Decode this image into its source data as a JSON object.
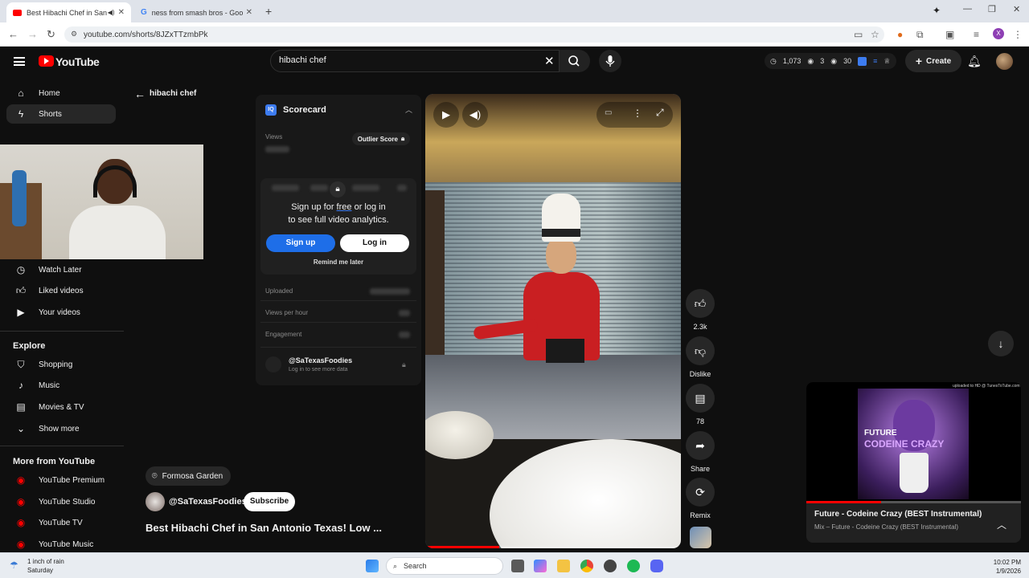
{
  "browser": {
    "tabs": [
      {
        "title": "Best Hibachi Chef in San Antonio",
        "active": true
      },
      {
        "title": "ness from smash bros - Google",
        "active": false
      }
    ],
    "url": "youtube.com/shorts/8JZxTTzmbPk"
  },
  "youtube": {
    "logo": "YouTube",
    "search": {
      "value": "hibachi chef"
    },
    "toolbar_stats": {
      "views": "1,073",
      "count_a": "3",
      "count_b": "30"
    },
    "create_label": "Create"
  },
  "sidebar": {
    "top": [
      {
        "label": "Home",
        "icon": "home-icon"
      },
      {
        "label": "Shorts",
        "icon": "shorts-icon",
        "active": true
      }
    ],
    "you": [
      {
        "label": "Watch Later",
        "icon": "clock-icon"
      },
      {
        "label": "Liked videos",
        "icon": "thumbs-up-icon"
      },
      {
        "label": "Your videos",
        "icon": "play-square-icon"
      }
    ],
    "explore_heading": "Explore",
    "explore": [
      {
        "label": "Shopping",
        "icon": "bag-icon"
      },
      {
        "label": "Music",
        "icon": "music-note-icon"
      },
      {
        "label": "Movies & TV",
        "icon": "film-icon"
      },
      {
        "label": "Show more",
        "icon": "chevron-down-icon"
      }
    ],
    "more_heading": "More from YouTube",
    "more": [
      {
        "label": "YouTube Premium"
      },
      {
        "label": "YouTube Studio"
      },
      {
        "label": "YouTube TV"
      },
      {
        "label": "YouTube Music"
      }
    ]
  },
  "shorts": {
    "back_title": "hibachi chef",
    "location": "Formosa Garden",
    "channel": "@SaTexasFoodies",
    "subscribe_label": "Subscribe",
    "title": "Best Hibachi Chef in San Antonio Texas! Low ...",
    "progress": 0.29,
    "actions": {
      "likes": "2.3k",
      "dislike": "Dislike",
      "comments": "78",
      "share": "Share",
      "remix": "Remix"
    }
  },
  "scorecard": {
    "title": "Scorecard",
    "views_label": "Views",
    "outlier_label": "Outlier Score",
    "signup_line1_pre": "Sign up for ",
    "signup_free": "free",
    "signup_line1_post": " or log in",
    "signup_line2": "to see full video analytics.",
    "signup_button": "Sign up",
    "login_button": "Log in",
    "remind_label": "Remind me later",
    "uploaded_label": "Uploaded",
    "vph_label": "Views per hour",
    "engagement_label": "Engagement",
    "channel": "@SaTexasFoodies",
    "channel_sub": "Log in to see more data"
  },
  "mini_player": {
    "title": "Future - Codeine Crazy (BEST Instrumental)",
    "subtitle": "Mix – Future - Codeine Crazy (BEST Instrumental)",
    "art_line1": "FUTURE",
    "art_line2": "CODEINE CRAZY",
    "watermark": "uploaded to HD @ TunesToTube.com",
    "progress": 0.35
  },
  "taskbar": {
    "weather_line1": "1 inch of rain",
    "weather_line2": "Saturday",
    "search_label": "Search",
    "time": "10:02 PM",
    "date": "1/9/2026"
  },
  "colors": {
    "yt_red": "#ff0000",
    "signup_blue": "#1e6ee8",
    "background": "#0f0f0f"
  }
}
